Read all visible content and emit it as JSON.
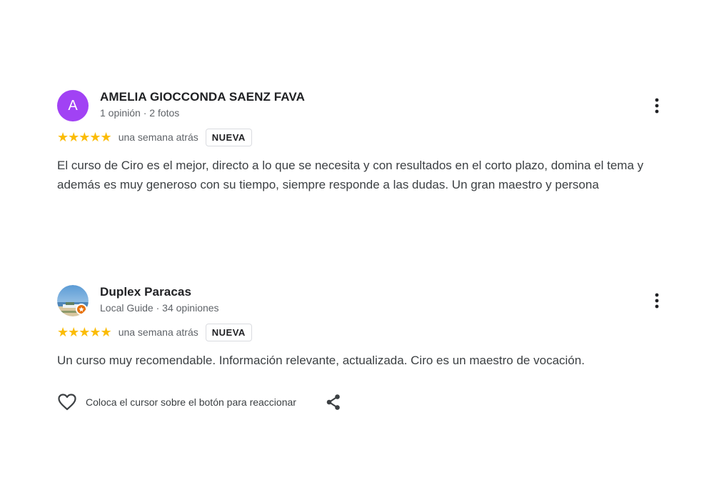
{
  "reviews": [
    {
      "avatar_letter": "A",
      "avatar_color": "#a142f4",
      "name": "AMELIA GIOCCONDA SAENZ FAVA",
      "meta": "1 opinión · 2 fotos",
      "stars": "★★★★★",
      "rating": 5,
      "when": "una semana atrás",
      "badge": "NUEVA",
      "text": "El curso de Ciro es el mejor, directo a lo que se necesita y con resultados en el corto plazo, domina el tema y además es muy generoso con su tiempo, siempre responde a las dudas. Un gran maestro y persona"
    },
    {
      "name": "Duplex Paracas",
      "meta": "Local Guide · 34 opiniones",
      "stars": "★★★★★",
      "rating": 5,
      "when": "una semana atrás",
      "badge": "NUEVA",
      "text": "Un curso muy recomendable. Información relevante, actualizada. Ciro es un maestro de vocación."
    }
  ],
  "actions": {
    "react_label": "Coloca el cursor sobre el botón para reaccionar"
  },
  "icons": {
    "more": "more-vert-icon",
    "heart": "heart-outline-icon",
    "share": "share-icon",
    "guide": "local-guide-star-icon"
  },
  "colors": {
    "star": "#fbbc04",
    "guide_badge": "#e8710a",
    "secondary_text": "#5f6368"
  }
}
